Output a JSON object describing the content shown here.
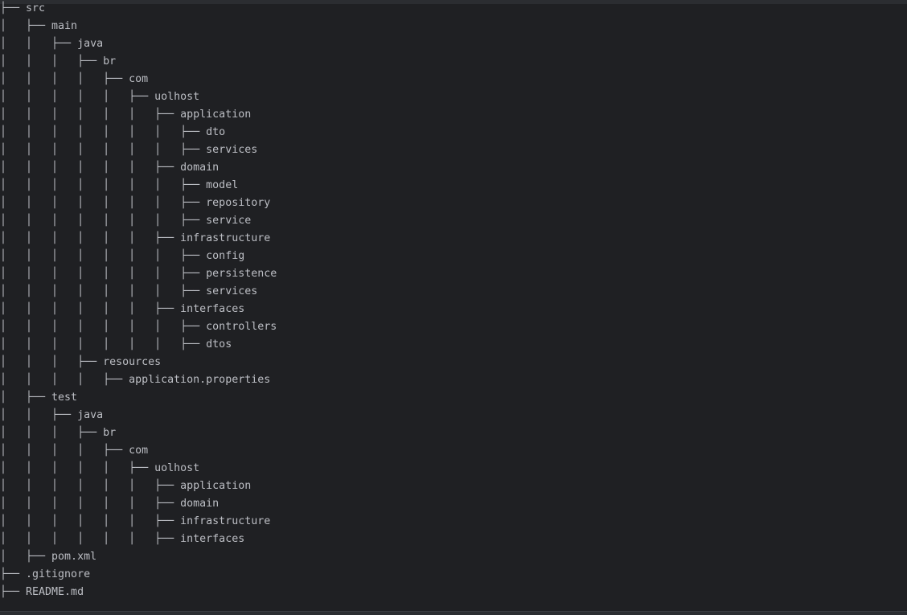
{
  "tree": {
    "lines": [
      "├── src",
      "│   ├── main",
      "│   │   ├── java",
      "│   │   │   ├── br",
      "│   │   │   │   ├── com",
      "│   │   │   │   │   ├── uolhost",
      "│   │   │   │   │   │   ├── application",
      "│   │   │   │   │   │   │   ├── dto",
      "│   │   │   │   │   │   │   ├── services",
      "│   │   │   │   │   │   ├── domain",
      "│   │   │   │   │   │   │   ├── model",
      "│   │   │   │   │   │   │   ├── repository",
      "│   │   │   │   │   │   │   ├── service",
      "│   │   │   │   │   │   ├── infrastructure",
      "│   │   │   │   │   │   │   ├── config",
      "│   │   │   │   │   │   │   ├── persistence",
      "│   │   │   │   │   │   │   ├── services",
      "│   │   │   │   │   │   ├── interfaces",
      "│   │   │   │   │   │   │   ├── controllers",
      "│   │   │   │   │   │   │   ├── dtos",
      "│   │   │   ├── resources",
      "│   │   │   │   ├── application.properties",
      "│   ├── test",
      "│   │   ├── java",
      "│   │   │   ├── br",
      "│   │   │   │   ├── com",
      "│   │   │   │   │   ├── uolhost",
      "│   │   │   │   │   │   ├── application",
      "│   │   │   │   │   │   ├── domain",
      "│   │   │   │   │   │   ├── infrastructure",
      "│   │   │   │   │   │   ├── interfaces",
      "│   ├── pom.xml",
      "├── .gitignore",
      "├── README.md"
    ]
  },
  "colors": {
    "background": "#1f2023",
    "text": "#bcbec4"
  }
}
